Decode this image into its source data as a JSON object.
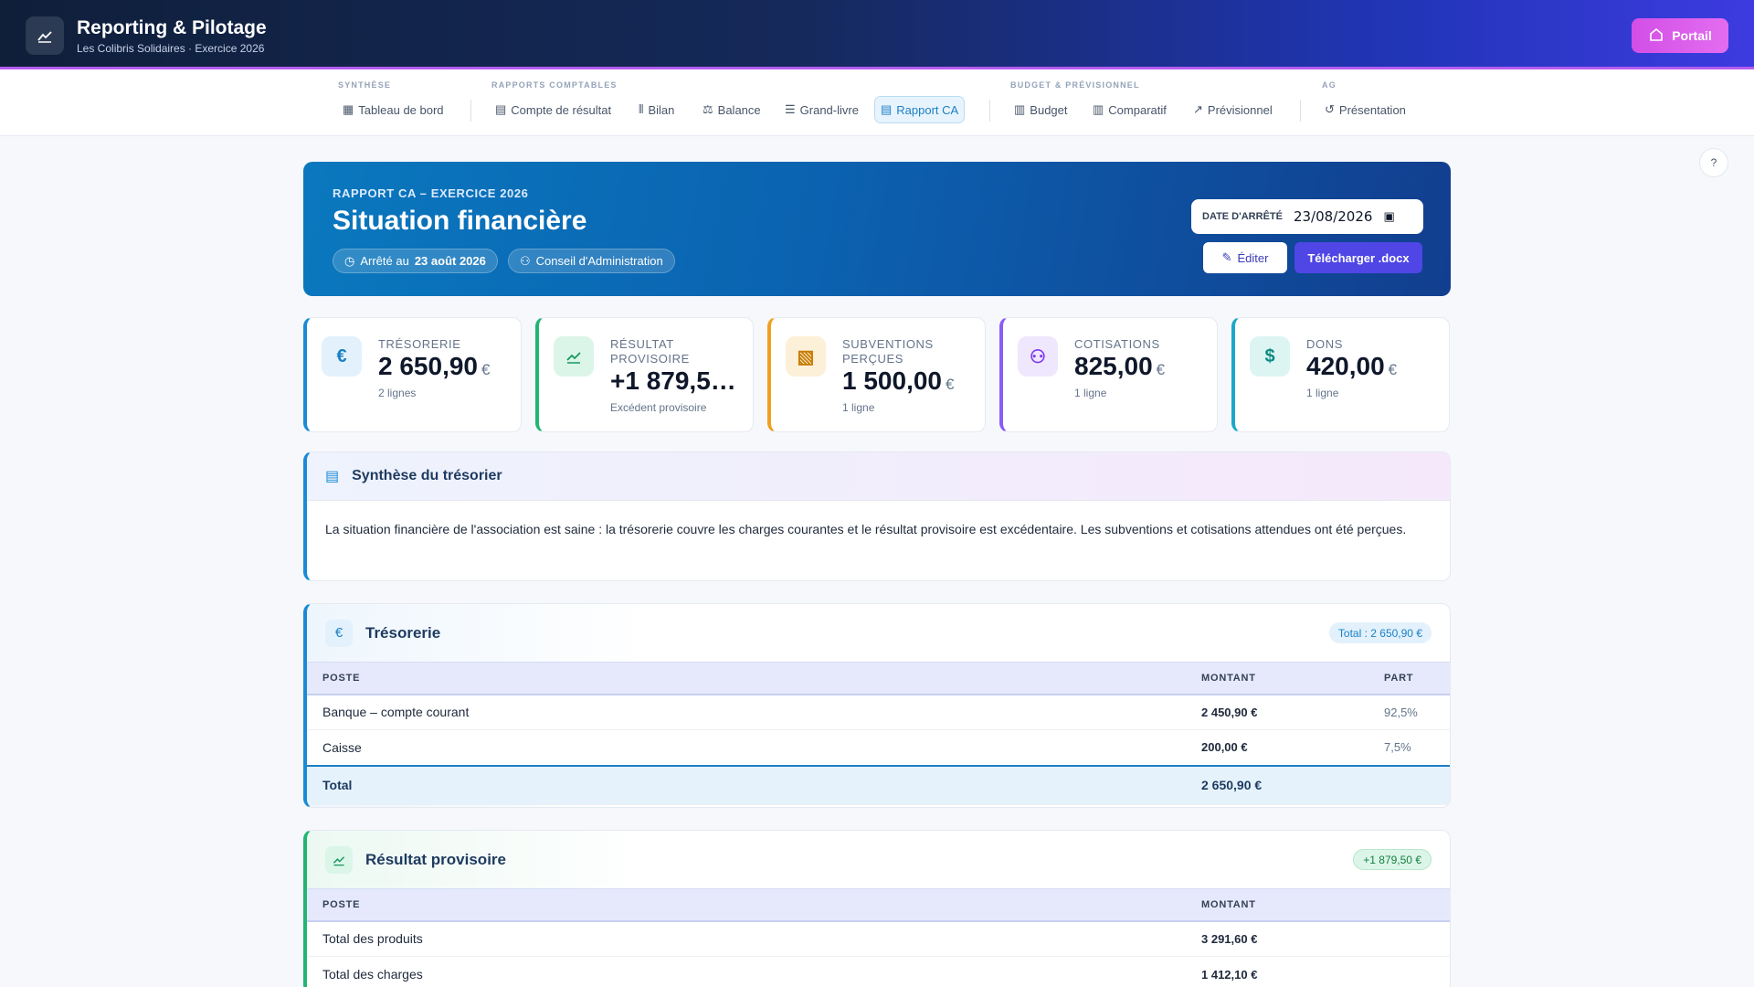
{
  "header": {
    "title": "Reporting & Pilotage",
    "subtitle": "Les Colibris Solidaires · Exercice 2026",
    "portal_label": "Portail"
  },
  "nav": {
    "groups": [
      {
        "label": "SYNTHÈSE"
      },
      {
        "label": "RAPPORTS COMPTABLES"
      },
      {
        "label": "BUDGET & PRÉVISIONNEL"
      },
      {
        "label": "AG"
      }
    ],
    "items": [
      {
        "label": "Tableau de bord",
        "icon": "grid-icon"
      },
      {
        "label": "Compte de résultat",
        "icon": "document-icon"
      },
      {
        "label": "Bilan",
        "icon": "columns-icon"
      },
      {
        "label": "Balance",
        "icon": "scale-icon"
      },
      {
        "label": "Grand-livre",
        "icon": "list-icon"
      },
      {
        "label": "Rapport CA",
        "icon": "document-icon",
        "active": true
      },
      {
        "label": "Budget",
        "icon": "clipboard-icon"
      },
      {
        "label": "Comparatif",
        "icon": "bar-chart-icon"
      },
      {
        "label": "Prévisionnel",
        "icon": "trend-icon"
      },
      {
        "label": "Présentation",
        "icon": "history-icon"
      }
    ],
    "help_label": "?"
  },
  "hero": {
    "kicker": "RAPPORT CA – EXERCICE 2026",
    "title": "Situation financière",
    "arrete_prefix": "Arrêté au",
    "arrete_date": "23 août 2026",
    "conseil": "Conseil d'Administration",
    "date_label": "DATE D'ARRÊTÉ",
    "date_value": "23/08/2026",
    "edit_label": "Éditer",
    "download_label": "Télécharger .docx"
  },
  "kpis": [
    {
      "label": "TRÉSORERIE",
      "value": "2 650,90",
      "currency": "€",
      "note": "2 lignes",
      "color": "#1b8ad6",
      "icon_bg": "#e2f1fc",
      "icon_color": "#1b7fc4"
    },
    {
      "label": "RÉSULTAT PROVISOIRE",
      "value": "+1 879,5…",
      "currency": "",
      "note": "Excédent provisoire",
      "color": "#22b573",
      "icon_bg": "#dcf5e9",
      "icon_color": "#16995e"
    },
    {
      "label": "SUBVENTIONS PERÇUES",
      "value": "1 500,00",
      "currency": "€",
      "note": "1 ligne",
      "color": "#f0a020",
      "icon_bg": "#fdf0d8",
      "icon_color": "#c77c06"
    },
    {
      "label": "COTISATIONS",
      "value": "825,00",
      "currency": "€",
      "note": "1 ligne",
      "color": "#8b5cf6",
      "icon_bg": "#efe7fd",
      "icon_color": "#7c3aed"
    },
    {
      "label": "DONS",
      "value": "420,00",
      "currency": "€",
      "note": "1 ligne",
      "color": "#1ba8c9",
      "icon_bg": "#dcf5f3",
      "icon_color": "#0e8a83"
    }
  ],
  "synthese": {
    "title": "Synthèse du trésorier",
    "text": "La situation financière de l'association est saine : la trésorerie couvre les charges courantes et le résultat provisoire est excédentaire. Les subventions et cotisations attendues ont été perçues."
  },
  "tresorerie": {
    "title": "Trésorerie",
    "badge": "Total : 2 650,90 €",
    "columns": [
      "POSTE",
      "MONTANT",
      "PART"
    ],
    "rows": [
      {
        "poste": "Banque – compte courant",
        "montant": "2 450,90 €",
        "part": "92,5%"
      },
      {
        "poste": "Caisse",
        "montant": "200,00 €",
        "part": "7,5%"
      }
    ],
    "total_label": "Total",
    "total_value": "2 650,90 €"
  },
  "resultat": {
    "title": "Résultat provisoire",
    "badge": "+1 879,50 €",
    "columns": [
      "POSTE",
      "MONTANT"
    ],
    "rows": [
      {
        "poste": "Total des produits",
        "montant": "3 291,60 €"
      },
      {
        "poste": "Total des charges",
        "montant": "1 412,10 €"
      }
    ]
  }
}
